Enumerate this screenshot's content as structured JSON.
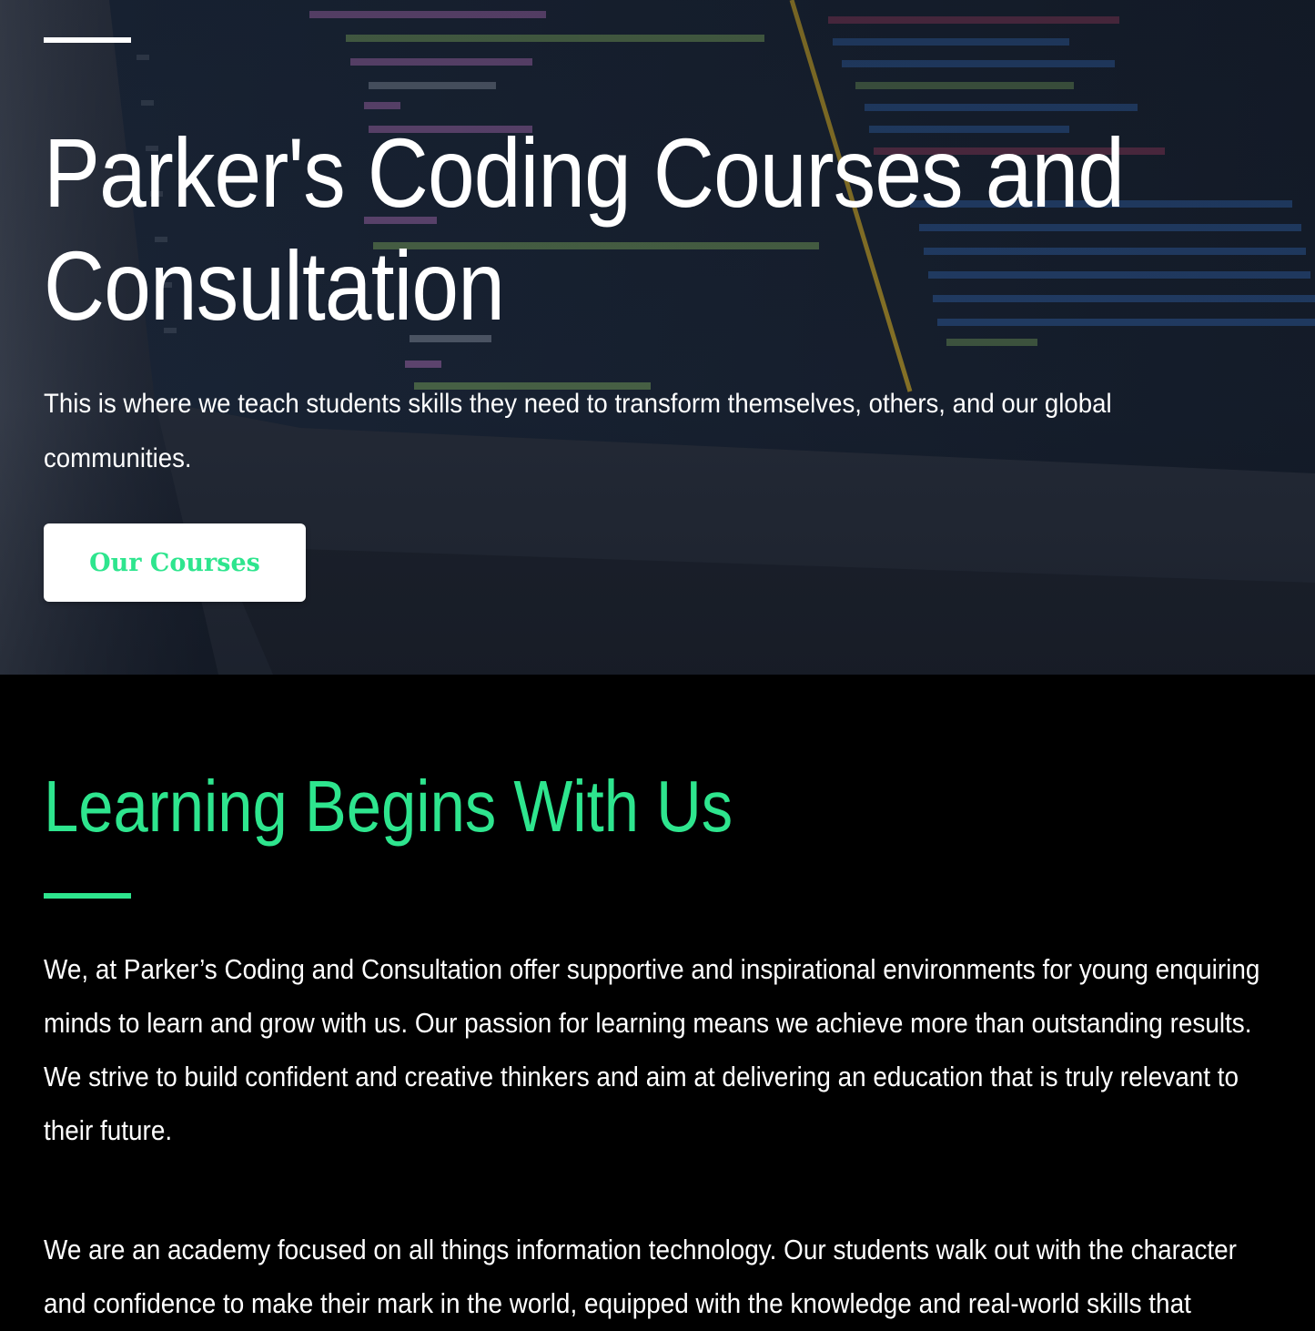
{
  "hero": {
    "title": "Parker's Coding Courses and Consultation",
    "subtitle": "This is where we teach students skills they need to transform themselves, others, and our global communities.",
    "cta_label": "Our Courses"
  },
  "about": {
    "title": "Learning Begins With Us",
    "paragraphs": [
      "We, at Parker’s Coding and Consultation offer supportive and inspirational environments for young enquiring minds to learn and grow with us. Our passion for learning means we achieve more than outstanding results. We strive to build confident and creative thinkers and aim at delivering an education that is truly relevant to their future.",
      "We are an academy focused on all things information technology. Our students walk out with the character and confidence to make their mark in the world, equipped with the knowledge and real-world skills that"
    ]
  },
  "colors": {
    "accent": "#2ee58e",
    "background": "#000000",
    "text": "#ffffff"
  }
}
